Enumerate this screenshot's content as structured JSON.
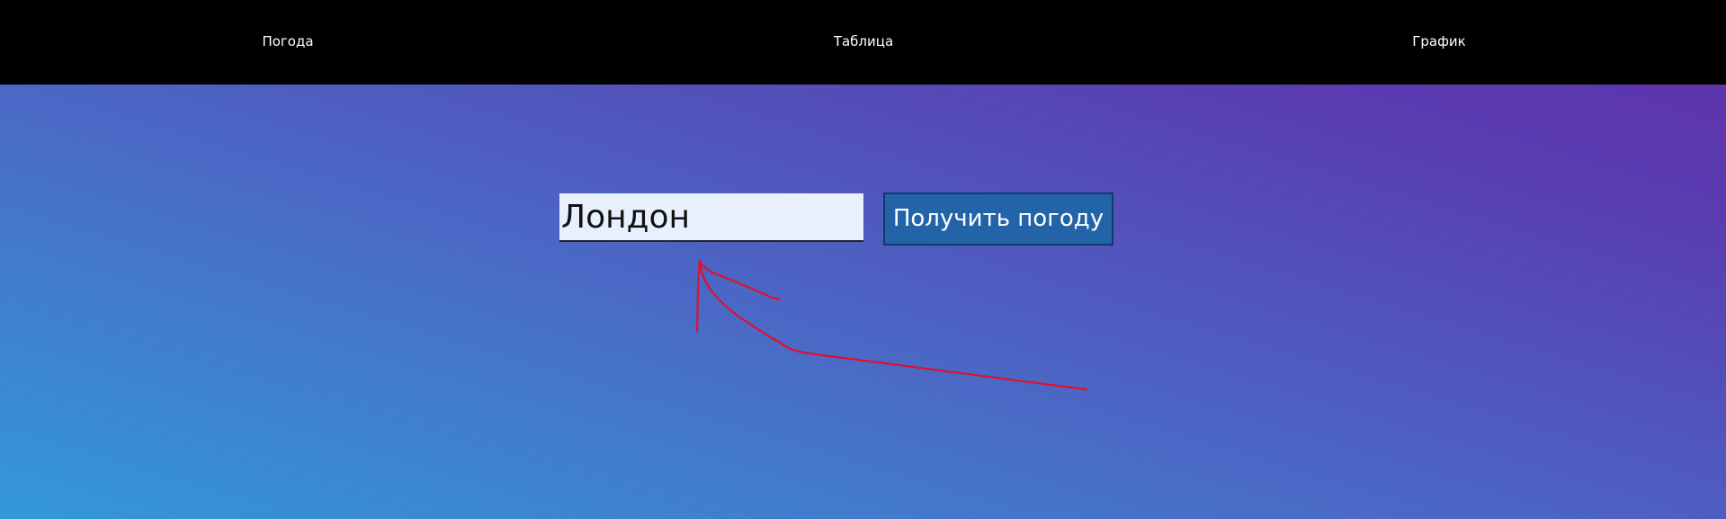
{
  "nav": {
    "items": [
      "Погода",
      "Таблица",
      "График"
    ]
  },
  "search": {
    "value": "Лондон",
    "button_label": "Получить погоду"
  },
  "colors": {
    "nav_background": "#000000",
    "button_background": "#2363a8",
    "input_background": "#e9f0fd",
    "annotation_arrow": "#e0102a"
  }
}
